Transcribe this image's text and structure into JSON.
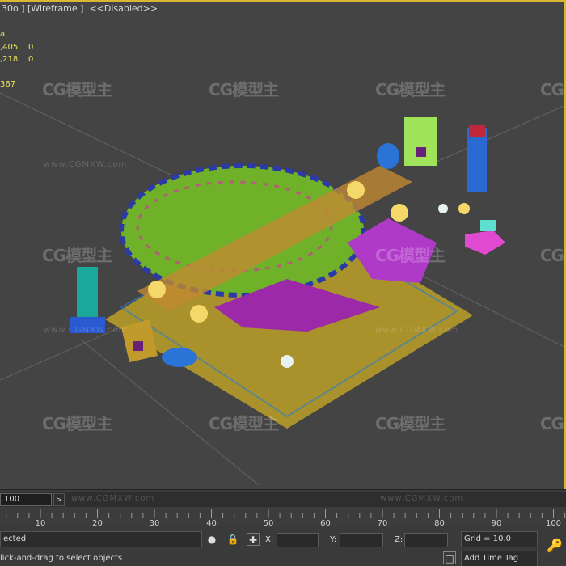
{
  "viewport": {
    "label": "30o ] [Wireframe ]  <<Disabled>>",
    "stats": [
      {
        "text": "al"
      },
      {
        "text": ",405"
      },
      {
        "text": "0"
      },
      {
        "text": ",218"
      },
      {
        "text": "0"
      },
      {
        "text": "367"
      }
    ],
    "watermark": {
      "logo": "CG模型主",
      "url": "www.CGMXW.com"
    }
  },
  "timeline": {
    "frame_value": "100",
    "arrow": ">",
    "watermark_url": "www.CGMXW.com",
    "ticks": [
      "10",
      "20",
      "30",
      "40",
      "50",
      "60",
      "70",
      "80",
      "90",
      "100"
    ]
  },
  "statusbar": {
    "selection": "ected",
    "prompt": "lick-and-drag to select objects",
    "x_label": "X:",
    "y_label": "Y:",
    "z_label": "Z:",
    "grid": "Grid = 10.0",
    "add_time_tag": "Add Time Tag"
  },
  "colors": {
    "viewport_bg": "#444444",
    "active_border": "#d8b830",
    "stats_text": "#e8e35a"
  }
}
